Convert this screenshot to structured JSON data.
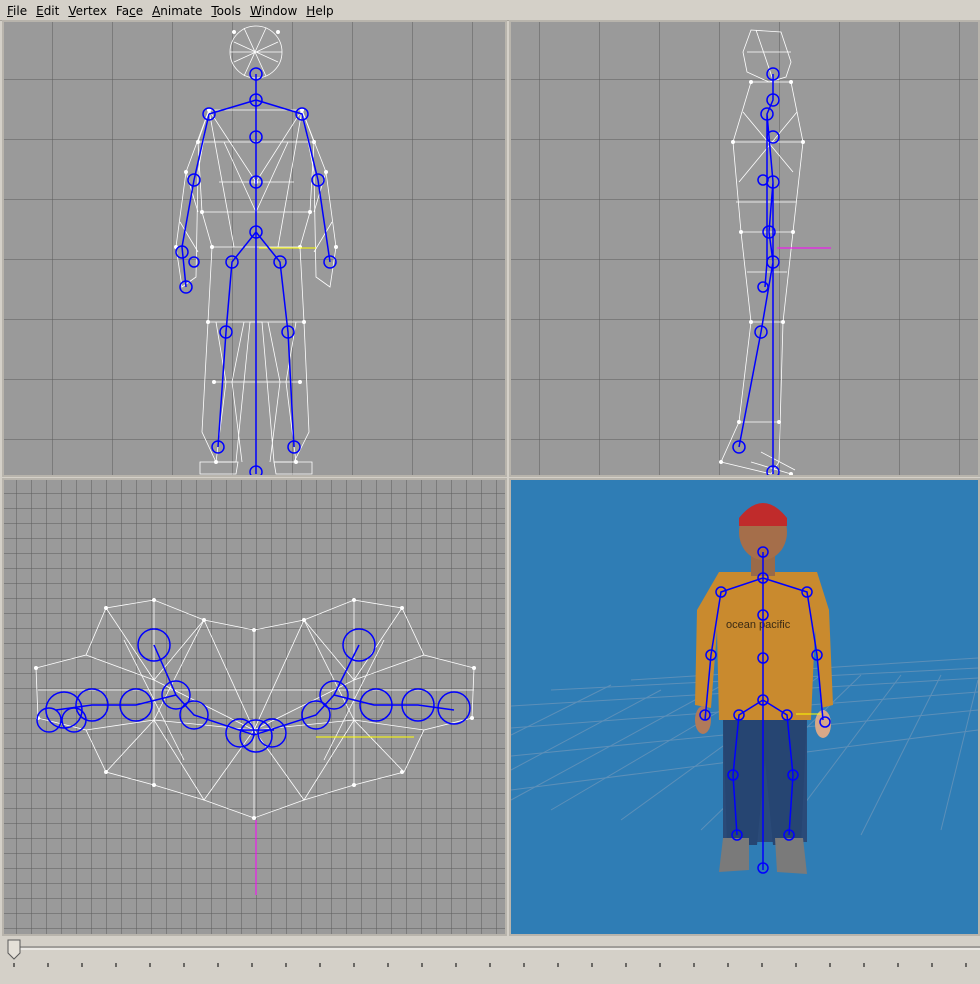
{
  "menubar": {
    "items": [
      {
        "pre": "",
        "u": "F",
        "post": "ile"
      },
      {
        "pre": "",
        "u": "E",
        "post": "dit"
      },
      {
        "pre": "",
        "u": "V",
        "post": "ertex"
      },
      {
        "pre": "Fa",
        "u": "c",
        "post": "e"
      },
      {
        "pre": "",
        "u": "A",
        "post": "nimate"
      },
      {
        "pre": "",
        "u": "T",
        "post": "ools"
      },
      {
        "pre": "",
        "u": "W",
        "post": "indow"
      },
      {
        "pre": "",
        "u": "H",
        "post": "elp"
      }
    ]
  },
  "viewports": {
    "front": {
      "view": "front"
    },
    "side": {
      "view": "side"
    },
    "top": {
      "view": "top"
    },
    "perspective": {
      "view": "3d"
    }
  },
  "model": {
    "shirt_text": "ocean pacific"
  },
  "colors": {
    "viewport_bg": "#9a9a9a",
    "grid": "#5c5c5c",
    "bone": "#0000ff",
    "mesh": "#ffffff",
    "perspective_bg": "#2f7db5",
    "shirt": "#c98a2e",
    "jeans": "#2a4a78",
    "cap": "#c02b2b"
  },
  "timeline": {
    "position": 0.0
  }
}
